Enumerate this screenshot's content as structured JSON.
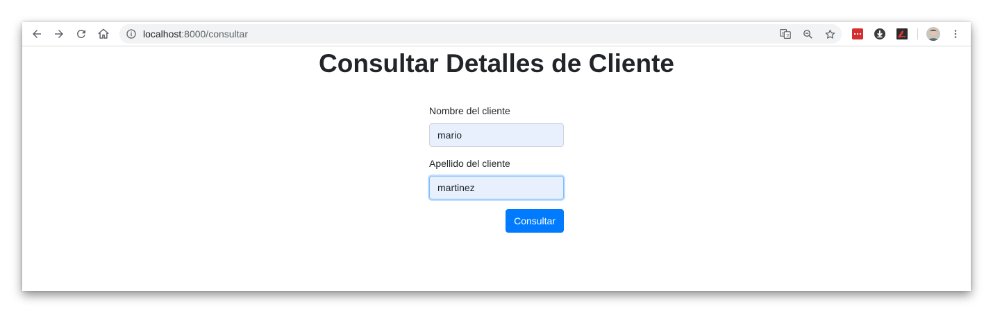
{
  "browser": {
    "url_host": "localhost",
    "url_path": ":8000/consultar",
    "icons": {
      "back": "arrow-left-icon",
      "forward": "arrow-right-icon",
      "reload": "reload-icon",
      "home": "home-icon",
      "info": "info-icon",
      "translate": "translate-icon",
      "zoom": "zoom-out-icon",
      "bookmark": "star-icon",
      "menu": "three-dot-menu-icon"
    }
  },
  "page": {
    "title": "Consultar Detalles de Cliente"
  },
  "form": {
    "first_name_label": "Nombre del cliente",
    "first_name_value": "mario",
    "last_name_label": "Apellido del cliente",
    "last_name_value": "martinez",
    "submit_label": "Consultar"
  },
  "colors": {
    "primary_button": "#007bff",
    "autofill_field": "#e8f0fe",
    "title_text": "#212529"
  }
}
